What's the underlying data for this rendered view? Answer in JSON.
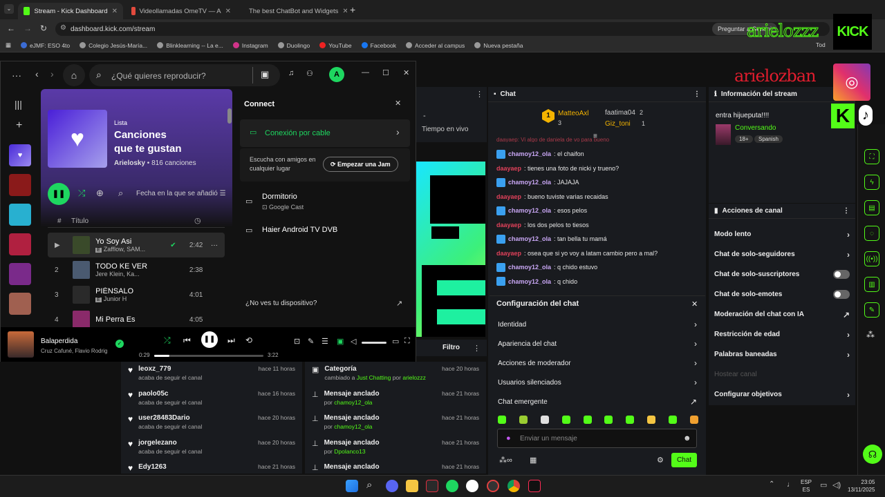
{
  "browser": {
    "tabs": [
      {
        "title": "Stream - Kick Dashboard",
        "icon": "kick-icon",
        "active": true
      },
      {
        "title": "Videollamadas OmeTV — A",
        "icon": "ometv-icon",
        "active": false
      },
      {
        "title": "The best ChatBot and Widgets",
        "icon": "botrix-icon",
        "active": false
      }
    ],
    "url": "dashboard.kick.com/stream",
    "ai_prompt": "Preguntar a Gemini",
    "bookmarks": [
      "eJMF: ESO 4to",
      "Colegio Jesús-María...",
      "Blinklearning -- La e...",
      "Instagram",
      "Duolingo",
      "YouTube",
      "Facebook",
      "Acceder al campus",
      "Nueva pestaña"
    ],
    "bookmarks_right": "Tod"
  },
  "overlay": {
    "name1": "arielozzz",
    "kick_logo": "KICK",
    "name2": "arielozban",
    "kick_k": "K"
  },
  "spotify": {
    "search_placeholder": "¿Qué quieres reproducir?",
    "avatar": "A",
    "playlist": {
      "type": "Lista",
      "title_line1": "Canciones",
      "title_line2": "que te gustan",
      "owner": "Arielosky",
      "count": "816 canciones"
    },
    "sort_label": "Fecha en la que se añadió",
    "col_num": "#",
    "col_title": "Título",
    "tracks": [
      {
        "num": "",
        "title": "Yo Soy Asi",
        "artist": "Zafflow, SAM...",
        "duration": "2:42",
        "explicit": true,
        "color": "#3a4a2a"
      },
      {
        "num": "2",
        "title": "TODO KE VER",
        "artist": "Jere Klein, Ka...",
        "duration": "2:38",
        "explicit": false,
        "color": "#4a5a70"
      },
      {
        "num": "3",
        "title": "PIÉNSALO",
        "artist": "Junior H",
        "duration": "4:01",
        "explicit": true,
        "color": "#2a2a2a"
      },
      {
        "num": "4",
        "title": "Mi Perra Es",
        "artist": "",
        "duration": "4:05",
        "explicit": false,
        "color": "#8a2a6a"
      }
    ],
    "connect": {
      "title": "Connect",
      "cable": "Conexión por cable",
      "listen_text": "Escucha con amigos en cualquier lugar",
      "jam_button": "Empezar una Jam",
      "devices": [
        {
          "name": "Dormitorio",
          "sub": "Google Cast"
        },
        {
          "name": "Haier Android TV DVB",
          "sub": ""
        }
      ],
      "missing": "¿No ves tu dispositivo?"
    },
    "now_playing": {
      "title": "Balaperdida",
      "artist": "Cruz Cafuné, Flavio Rodrigo",
      "elapsed": "0:29",
      "total": "3:22",
      "progress": 0.14
    }
  },
  "kick": {
    "mid_label": "Tiempo en vivo",
    "mid_dash": "-",
    "filter_label": "Filtro",
    "chat": {
      "title": "Chat",
      "top": [
        {
          "rank": "1",
          "name": "MatteoAxl",
          "count": "3"
        },
        {
          "rank": "",
          "name": "faatima04",
          "count": "2"
        },
        {
          "rank": "",
          "name": "Giz_toni",
          "count": "1"
        }
      ],
      "partial_line": "daayaep: Vi algo de daniela de vo para bueno",
      "messages": [
        {
          "user": "chamoy12_ola",
          "badge": true,
          "text": ": el chaifon"
        },
        {
          "user": "daayaep",
          "badge": false,
          "text": ": tienes una foto de nicki y trueno?"
        },
        {
          "user": "chamoy12_ola",
          "badge": true,
          "text": ": JAJAJA"
        },
        {
          "user": "daayaep",
          "badge": false,
          "text": ": bueno tuviste varias recaidas"
        },
        {
          "user": "chamoy12_ola",
          "badge": true,
          "text": ": esos pelos"
        },
        {
          "user": "daayaep",
          "badge": false,
          "text": ": los dos pelos to tiesos"
        },
        {
          "user": "chamoy12_ola",
          "badge": true,
          "text": ": tan bella tu mamá"
        },
        {
          "user": "daayaep",
          "badge": false,
          "text": ": osea que si yo voy a latam cambio pero a mal?"
        },
        {
          "user": "chamoy12_ola",
          "badge": true,
          "text": ": q chido estuvo"
        },
        {
          "user": "chamoy12_ola",
          "badge": true,
          "text": ": q chido"
        }
      ],
      "settings_title": "Configuración del chat",
      "settings": [
        "Identidad",
        "Apariencia del chat",
        "Acciones de moderador",
        "Usuarios silenciados",
        "Chat emergente"
      ],
      "input_placeholder": "Enviar un mensaje",
      "send_button": "Chat"
    },
    "stream_info": {
      "title": "Información del stream",
      "stream_title": "entra hijueputa!!!!",
      "category": "Conversando",
      "tags": [
        "18+",
        "Spanish"
      ]
    },
    "channel_actions": {
      "title": "Acciones de canal",
      "items": [
        {
          "label": "Modo lento",
          "kind": "chevron"
        },
        {
          "label": "Chat de solo-seguidores",
          "kind": "chevron"
        },
        {
          "label": "Chat de solo-suscriptores",
          "kind": "toggle"
        },
        {
          "label": "Chat de solo-emotes",
          "kind": "toggle"
        },
        {
          "label": "Moderación del chat con IA",
          "kind": "external"
        },
        {
          "label": "Restricción de edad",
          "kind": "chevron"
        },
        {
          "label": "Palabras baneadas",
          "kind": "chevron"
        },
        {
          "label": "Hostear canal",
          "kind": "disabled"
        },
        {
          "label": "Configurar objetivos",
          "kind": "chevron"
        }
      ]
    },
    "followers": [
      {
        "name": "leoxz_779",
        "action": "acaba de seguir el canal",
        "time": "hace 11 horas"
      },
      {
        "name": "paolo05c",
        "action": "acaba de seguir el canal",
        "time": "hace 16 horas"
      },
      {
        "name": "user28483Dario",
        "action": "acaba de seguir el canal",
        "time": "hace 20 horas"
      },
      {
        "name": "jorgelezano",
        "action": "acaba de seguir el canal",
        "time": "hace 20 horas"
      },
      {
        "name": "Edy1263",
        "action": "",
        "time": "hace 21 horas"
      }
    ],
    "activity": [
      {
        "title": "Categoría",
        "pre": "cambiado a ",
        "hl": "Just Chatting",
        "mid": " por ",
        "hl2": "arielozzz",
        "time": "hace 20 horas",
        "icon": "category-icon"
      },
      {
        "title": "Mensaje anclado",
        "pre": "por ",
        "hl": "chamoy12_ola",
        "mid": "",
        "hl2": "",
        "time": "hace 21 horas",
        "icon": "pin-icon"
      },
      {
        "title": "Mensaje anclado",
        "pre": "por ",
        "hl": "chamoy12_ola",
        "mid": "",
        "hl2": "",
        "time": "hace 21 horas",
        "icon": "pin-icon"
      },
      {
        "title": "Mensaje anclado",
        "pre": "por ",
        "hl": "Dpolanco13",
        "mid": "",
        "hl2": "",
        "time": "hace 21 horas",
        "icon": "pin-icon"
      },
      {
        "title": "Mensaje anclado",
        "pre": "",
        "hl": "",
        "mid": "",
        "hl2": "",
        "time": "hace 21 horas",
        "icon": "pin-icon"
      }
    ]
  },
  "taskbar": {
    "lang1": "ESP",
    "lang2": "ES",
    "time": "23:05",
    "date": "13/11/2025"
  },
  "colors": {
    "kick_green": "#53fc18",
    "spotify_green": "#1ed760",
    "chat_red": "#e0415a"
  }
}
